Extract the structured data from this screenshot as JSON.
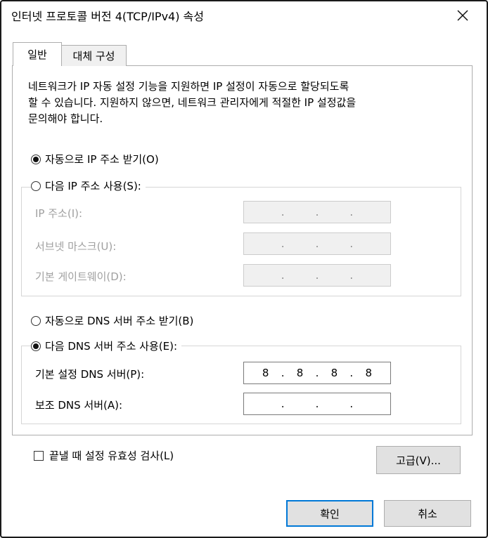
{
  "window": {
    "title": "인터넷 프로토콜 버전 4(TCP/IPv4) 속성"
  },
  "tabs": [
    {
      "label": "일반"
    },
    {
      "label": "대체 구성"
    }
  ],
  "description": [
    "네트워크가 IP 자동 설정 기능을 지원하면 IP 설정이 자동으로 할당되도록",
    "할 수 있습니다. 지원하지 않으면, 네트워크 관리자에게 적절한 IP 설정값을",
    "문의해야 합니다."
  ],
  "ip": {
    "auto_label": "자동으로 IP 주소 받기(O)",
    "manual_label": "다음 IP 주소 사용(S):",
    "fields": [
      {
        "label": "IP 주소(I):"
      },
      {
        "label": "서브넷 마스크(U):"
      },
      {
        "label": "기본 게이트웨이(D):"
      }
    ]
  },
  "dns": {
    "auto_label": "자동으로 DNS 서버 주소 받기(B)",
    "manual_label": "다음 DNS 서버 주소 사용(E):",
    "preferred_label": "기본 설정 DNS 서버(P):",
    "preferred_octets": [
      "8",
      "8",
      "8",
      "8"
    ],
    "alternate_label": "보조 DNS 서버(A):"
  },
  "validate_label": "끝낼 때 설정 유효성 검사(L)",
  "buttons": {
    "advanced": "고급(V)...",
    "ok": "확인",
    "cancel": "취소"
  }
}
